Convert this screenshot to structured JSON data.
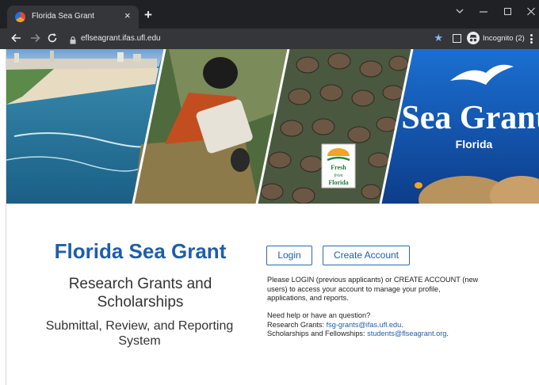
{
  "browser": {
    "tab_title": "Florida Sea Grant",
    "tab_close": "×",
    "new_tab": "+",
    "url": "eflseagrant.ifas.ufl.edu",
    "profile_label": "Incognito (2)",
    "accent_color": "#8ab4f8",
    "chrome_dark": "#202124",
    "toolbar_color": "#35363a"
  },
  "banner": {
    "logo_main": "Sea Grant",
    "logo_sub": "Florida",
    "badge_line1": "Fresh",
    "badge_line2": "from",
    "badge_line3": "Florida"
  },
  "left": {
    "title": "Florida Sea Grant",
    "subtitle": "Research Grants and Scholarships",
    "subtitle2": "Submittal, Review, and Reporting System",
    "title_color": "#1f5ea8"
  },
  "actions": {
    "login_label": "Login",
    "create_label": "Create Account"
  },
  "info": {
    "description": "Please LOGIN (previous applicants) or CREATE ACCOUNT (new users) to access your account to manage your profile, applications, and reports.",
    "help_question": "Need help or have an question?",
    "research_prefix": "Research Grants: ",
    "research_email": "fsg-grants@ifas.ufl.edu",
    "research_suffix": ".",
    "scholar_prefix": "Scholarships and Fellowships: ",
    "scholar_email": "students@flseagrant.org",
    "scholar_suffix": "."
  }
}
